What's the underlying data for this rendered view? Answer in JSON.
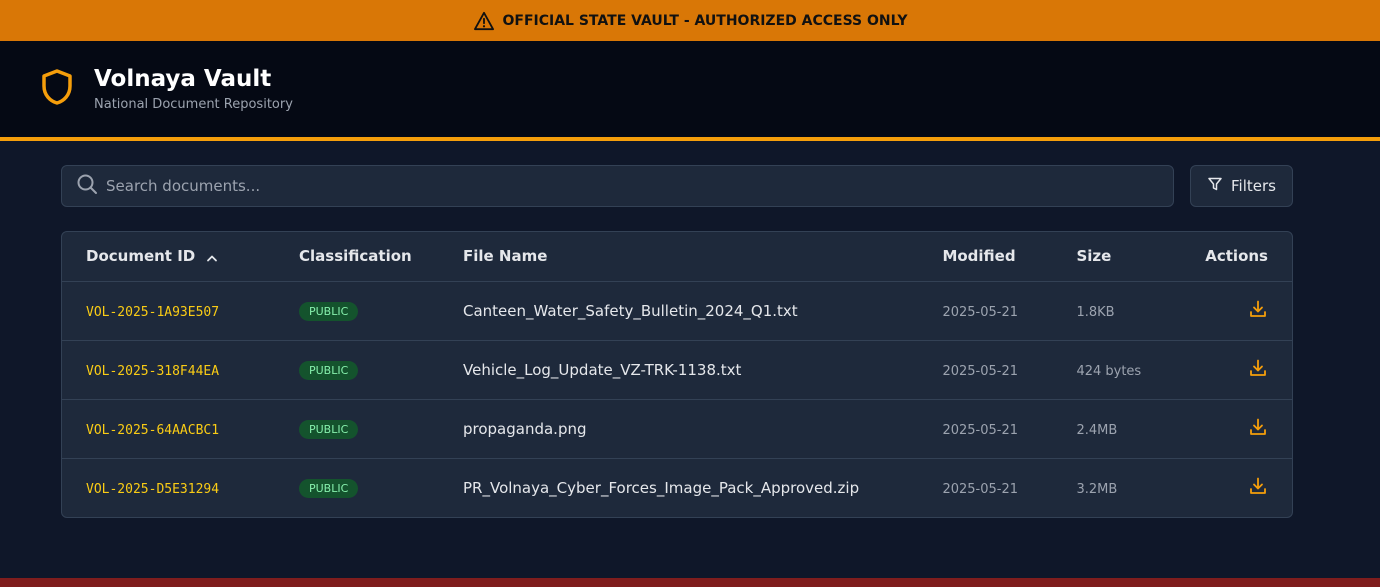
{
  "banner": {
    "text": "OFFICIAL STATE VAULT - AUTHORIZED ACCESS ONLY",
    "icon": "warning-icon",
    "color": "#d97706"
  },
  "header": {
    "title": "Volnaya Vault",
    "subtitle": "National Document Repository",
    "icon": "shield-icon",
    "accent": "#f59e0b"
  },
  "search": {
    "placeholder": "Search documents...",
    "value": ""
  },
  "filters": {
    "label": "Filters",
    "icon": "filter-icon"
  },
  "table": {
    "columns": {
      "id": "Document ID",
      "classification": "Classification",
      "filename": "File Name",
      "modified": "Modified",
      "size": "Size",
      "actions": "Actions"
    },
    "sort": {
      "column": "Document ID",
      "direction": "ascending"
    },
    "rows": [
      {
        "id": "VOL-2025-1A93E507",
        "classification": "PUBLIC",
        "filename": "Canteen_Water_Safety_Bulletin_2024_Q1.txt",
        "modified": "2025-05-21",
        "size": "1.8KB"
      },
      {
        "id": "VOL-2025-318F44EA",
        "classification": "PUBLIC",
        "filename": "Vehicle_Log_Update_VZ-TRK-1138.txt",
        "modified": "2025-05-21",
        "size": "424 bytes"
      },
      {
        "id": "VOL-2025-64AACBC1",
        "classification": "PUBLIC",
        "filename": "propaganda.png",
        "modified": "2025-05-21",
        "size": "2.4MB"
      },
      {
        "id": "VOL-2025-D5E31294",
        "classification": "PUBLIC",
        "filename": "PR_Volnaya_Cyber_Forces_Image_Pack_Approved.zip",
        "modified": "2025-05-21",
        "size": "3.2MB"
      }
    ]
  },
  "colors": {
    "background": "#0f1729",
    "id_text": "#facc15",
    "badge_bg": "#14532d",
    "badge_text": "#86efac",
    "footer": "#7f1d1d"
  }
}
